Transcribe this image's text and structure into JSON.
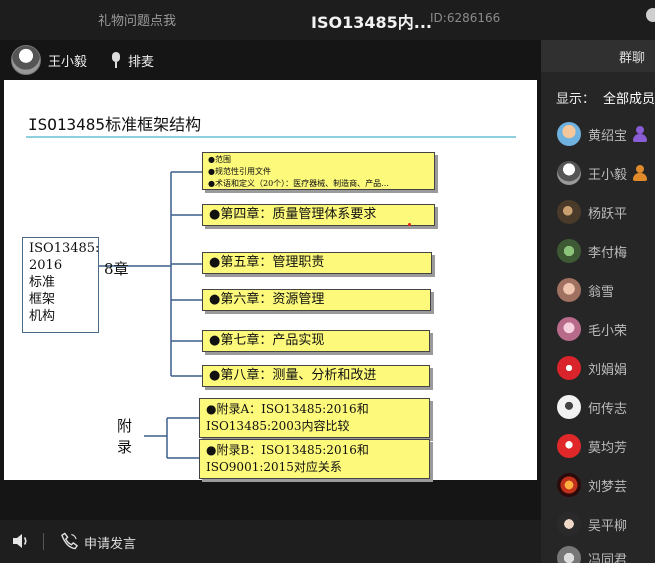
{
  "topbar": {
    "gift_label": "礼物问题点我",
    "title": "ISO13485内...",
    "room_id": "ID:6286166"
  },
  "presenter": {
    "name": "王小毅",
    "mic_label": "排麦"
  },
  "slide": {
    "title": "ISO13485标准框架结构",
    "root_lines": [
      "ISO13485:",
      "2016",
      "标准",
      "框架",
      "机构"
    ],
    "eight_chapters": "8章",
    "appendix_label": [
      "附",
      "录"
    ],
    "intro_lines": [
      "●范围",
      "●规范性引用文件",
      "●术语和定义（20个）：医疗器械、制造商、产品..."
    ],
    "chapters": [
      "●第四章：质量管理体系要求",
      "●第五章：管理职责",
      "●第六章：资源管理",
      "●第七章：产品实现",
      "●第八章：测量、分析和改进"
    ],
    "appendix_a": [
      "●附录A：ISO13485:2016和",
      "ISO13485:2003内容比较"
    ],
    "appendix_b": [
      "●附录B：ISO13485:2016和",
      "ISO9001:2015对应关系"
    ]
  },
  "bottombar": {
    "apply_label": "申请发言"
  },
  "sidebar": {
    "tab_label": "群聊",
    "filter_label": "显示：",
    "filter_value": "全部成员",
    "members": [
      {
        "name": "黄绍宝",
        "badge": true,
        "badge_color": "#8a5cd6"
      },
      {
        "name": "王小毅",
        "badge": true,
        "badge_color": "#e08a2a"
      },
      {
        "name": "杨跃平",
        "badge": false
      },
      {
        "name": "李付梅",
        "badge": false
      },
      {
        "name": "翁雪",
        "badge": false
      },
      {
        "name": "毛小荣",
        "badge": false
      },
      {
        "name": "刘娟娟",
        "badge": false
      },
      {
        "name": "何传志",
        "badge": false
      },
      {
        "name": "莫均芳",
        "badge": false
      },
      {
        "name": "刘梦芸",
        "badge": false
      },
      {
        "name": "吴平柳",
        "badge": false
      },
      {
        "name": "冯同君",
        "badge": false
      }
    ]
  }
}
